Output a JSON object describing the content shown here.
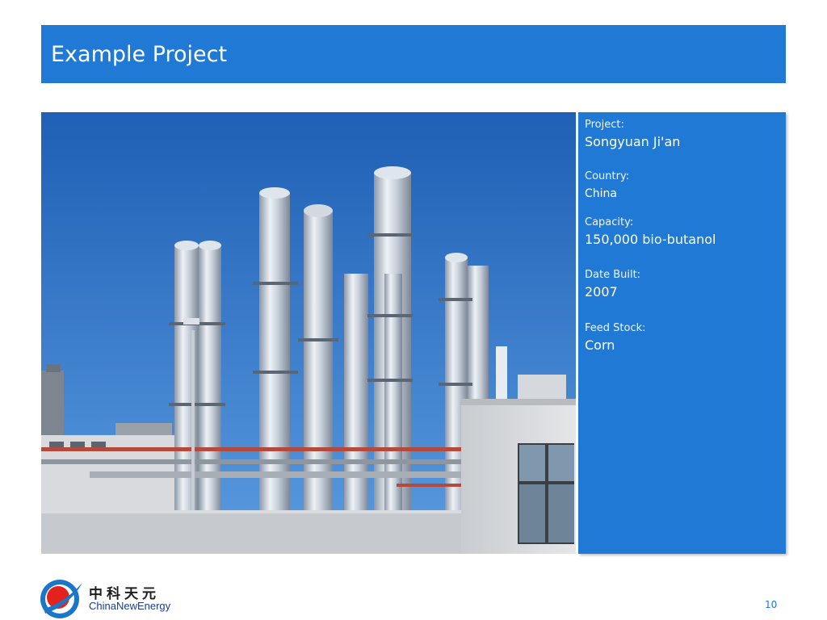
{
  "slide": {
    "title": "Example Project",
    "page_number": "10"
  },
  "project_info": {
    "project_label": "Project:",
    "project_value": "Songyuan Ji'an",
    "country_label": "Country:",
    "country_value": "China",
    "capacity_label": "Capacity:",
    "capacity_value": "150,000 bio-butanol",
    "date_built_label": "Date Built:",
    "date_built_value": "2007",
    "feed_stock_label": "Feed Stock:",
    "feed_stock_value": "Corn"
  },
  "logo": {
    "name_cn": "中科天元",
    "name_en": "ChinaNewEnergy"
  },
  "colors": {
    "accent": "#2179d6",
    "logo_red": "#e3221e",
    "logo_blue": "#1a76c9"
  }
}
